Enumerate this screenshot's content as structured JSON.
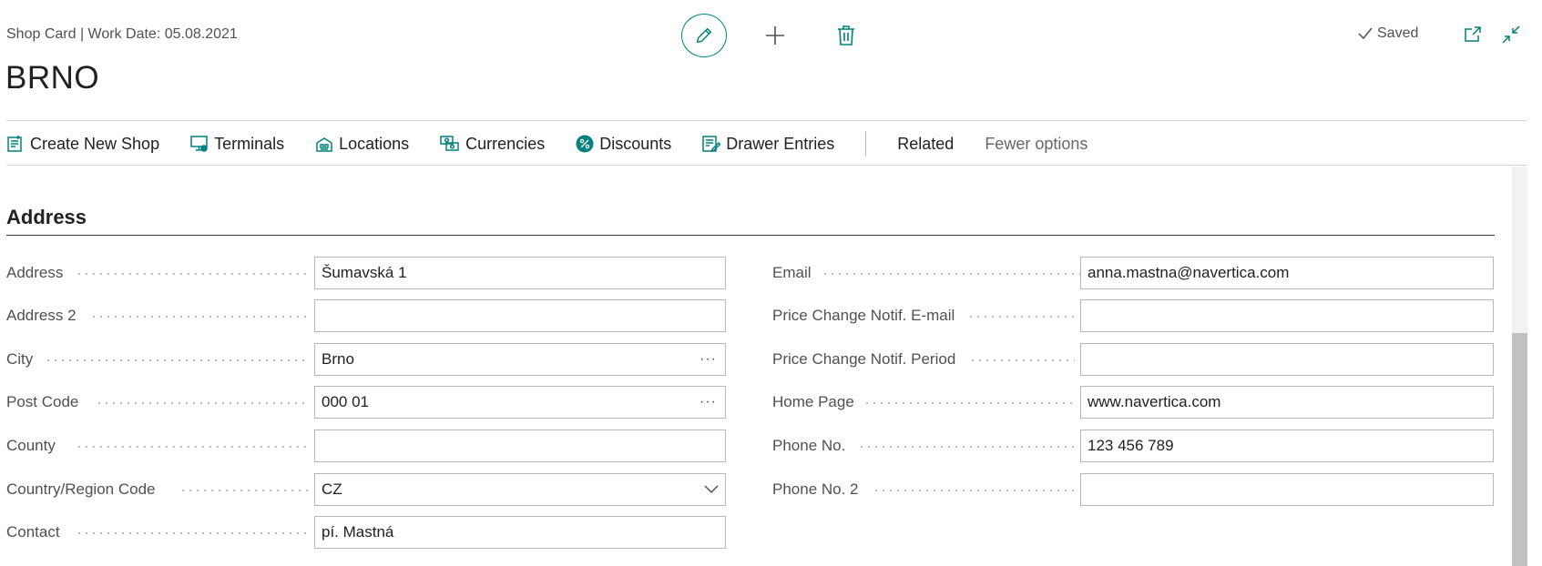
{
  "header": {
    "caption": "Shop Card | Work Date: 05.08.2021",
    "title": "BRNO",
    "status": "Saved",
    "icons": [
      "edit-icon",
      "add-icon",
      "delete-icon",
      "check-icon",
      "open-new-window-icon",
      "collapse-icon"
    ],
    "accent_color": "#00807e"
  },
  "actions": {
    "items": [
      {
        "label": "Create New Shop",
        "icon": "new-shop-icon"
      },
      {
        "label": "Terminals",
        "icon": "terminal-icon"
      },
      {
        "label": "Locations",
        "icon": "locations-icon"
      },
      {
        "label": "Currencies",
        "icon": "currencies-icon"
      },
      {
        "label": "Discounts",
        "icon": "discount-icon"
      },
      {
        "label": "Drawer Entries",
        "icon": "drawer-entries-icon"
      }
    ],
    "related": "Related",
    "fewer_options": "Fewer options"
  },
  "section": {
    "title": "Address",
    "left": [
      {
        "label": "Address",
        "value": "Šumavská 1"
      },
      {
        "label": "Address 2",
        "value": ""
      },
      {
        "label": "City",
        "value": "Brno",
        "assist": "···"
      },
      {
        "label": "Post Code",
        "value": "000 01",
        "assist": "···"
      },
      {
        "label": "County",
        "value": ""
      },
      {
        "label": "Country/Region Code",
        "value": "CZ"
      },
      {
        "label": "Contact",
        "value": "pí. Mastná"
      }
    ],
    "right": [
      {
        "label": "Email",
        "value": "anna.mastna@navertica.com"
      },
      {
        "label": "Price Change Notif. E-mail",
        "value": ""
      },
      {
        "label": "Price Change Notif. Period",
        "value": ""
      },
      {
        "label": "Home Page",
        "value": "www.navertica.com"
      },
      {
        "label": "Phone No.",
        "value": "123 456 789"
      },
      {
        "label": "Phone No. 2",
        "value": ""
      }
    ]
  }
}
